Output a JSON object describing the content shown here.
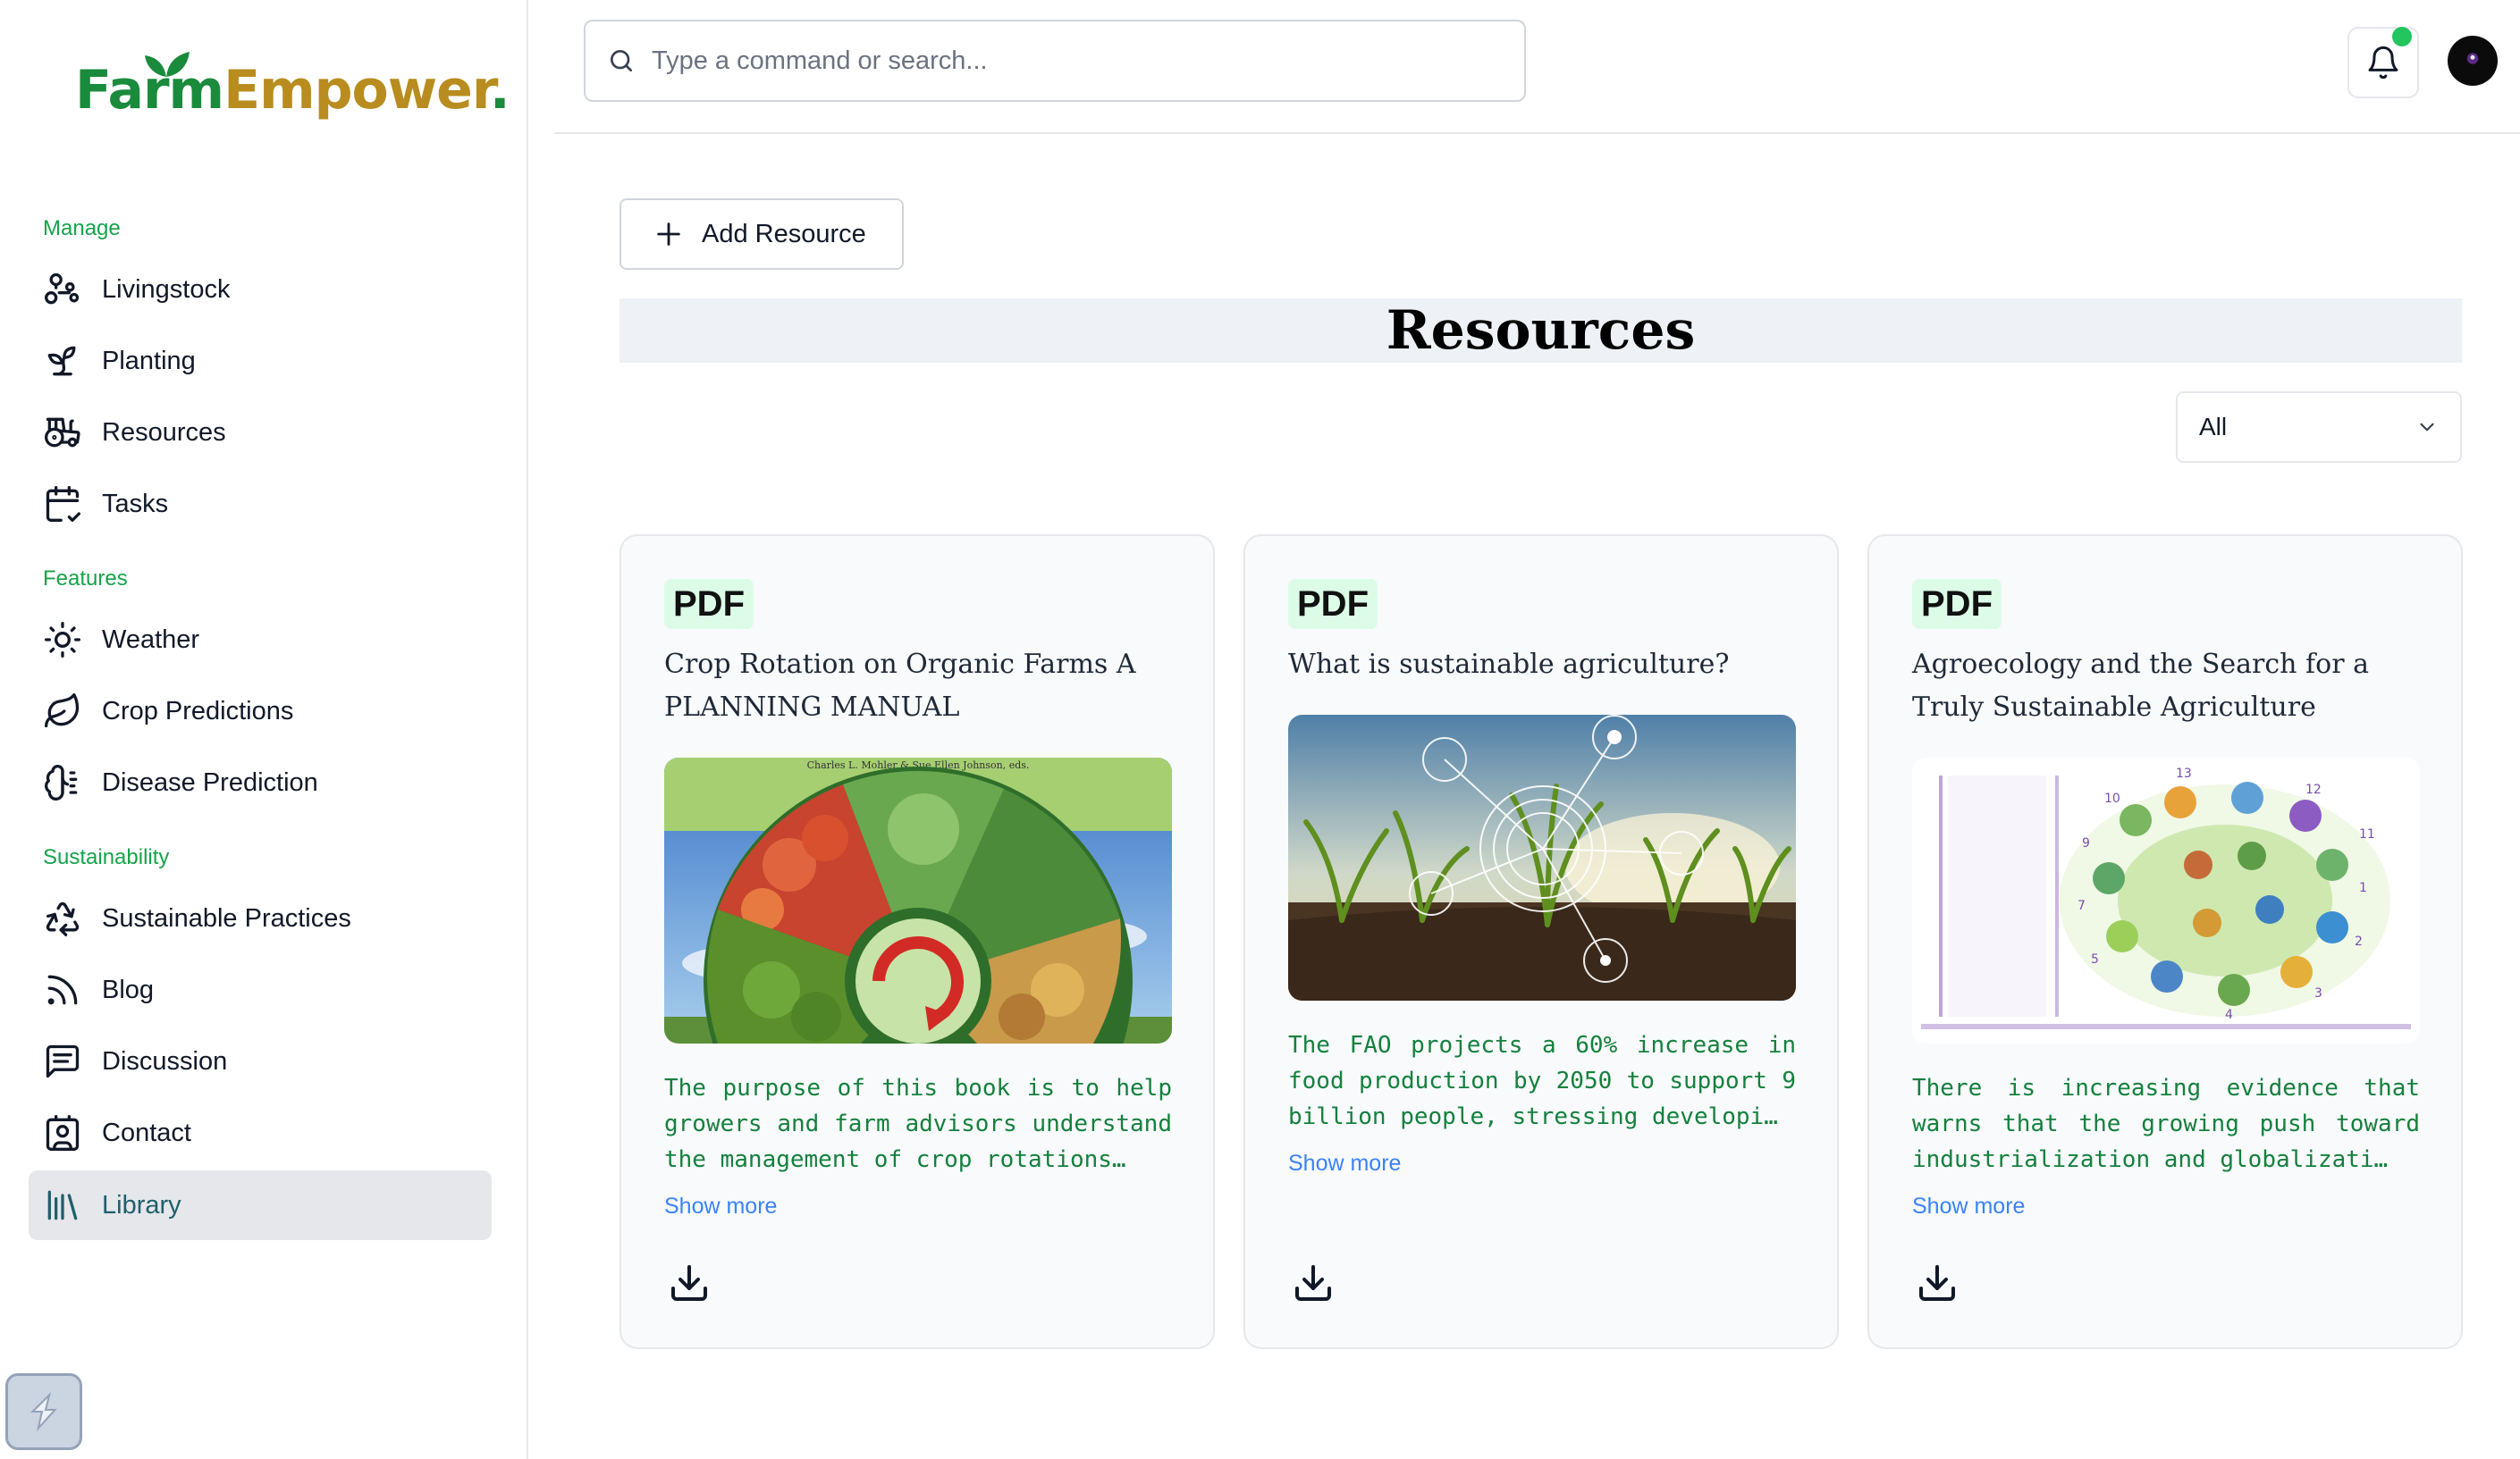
{
  "brand": {
    "part1": "Farm",
    "part2": "Empower",
    "dot": ".",
    "green": "#1a8a3c",
    "gold": "#b88c1e"
  },
  "sidebar": {
    "sections": [
      {
        "title": "Manage"
      },
      {
        "title": "Features"
      },
      {
        "title": "Sustainability"
      }
    ],
    "items": [
      {
        "label": "Livingstock",
        "icon": "livestock-icon"
      },
      {
        "label": "Planting",
        "icon": "sprout-icon"
      },
      {
        "label": "Resources",
        "icon": "tractor-icon"
      },
      {
        "label": "Tasks",
        "icon": "calendar-check-icon"
      },
      {
        "label": "Weather",
        "icon": "sun-icon"
      },
      {
        "label": "Crop Predictions",
        "icon": "leaf-icon"
      },
      {
        "label": "Disease Prediction",
        "icon": "brain-icon"
      },
      {
        "label": "Sustainable Practices",
        "icon": "recycle-icon"
      },
      {
        "label": "Blog",
        "icon": "rss-icon"
      },
      {
        "label": "Discussion",
        "icon": "message-square-icon"
      },
      {
        "label": "Contact",
        "icon": "contact-icon"
      },
      {
        "label": "Library",
        "icon": "library-icon",
        "active": true
      }
    ]
  },
  "search": {
    "placeholder": "Type a command or search..."
  },
  "main": {
    "add_label": "Add Resource",
    "title": "Resources",
    "filter": {
      "selected": "All"
    },
    "cards": [
      {
        "tag": "PDF",
        "title": "Crop Rotation on Organic Farms A PLANNING MANUAL",
        "image_caption": "Charles L. Mohler & Sue Ellen Johnson, eds.",
        "description": "The purpose of this book is to help growers and farm advisors understand the management of crop rotations…",
        "show_more": "Show more"
      },
      {
        "tag": "PDF",
        "title": "What is sustainable agriculture?",
        "description": "The FAO projects a 60% increase in food production by 2050 to support 9 billion people, stressing developi…",
        "show_more": "Show more"
      },
      {
        "tag": "PDF",
        "title": "Agroecology and the Search for a Truly Sustainable Agriculture",
        "description": "There is increasing evidence that warns that the growing push toward industrialization and globalizati…",
        "show_more": "Show more"
      }
    ]
  },
  "colors": {
    "accent_green": "#16a34a",
    "text_green": "#15803d",
    "link_blue": "#3b82f6",
    "tag_bg": "#dcfce7",
    "active_bg": "#e5e7eb",
    "notification": "#22c55e"
  }
}
